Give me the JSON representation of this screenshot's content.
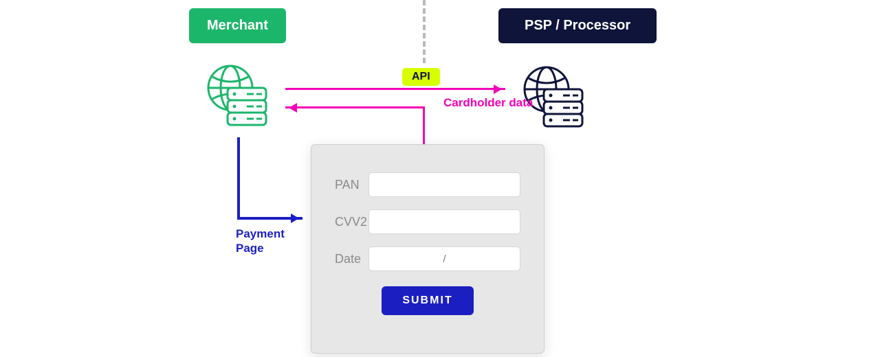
{
  "nodes": {
    "merchant": "Merchant",
    "psp": "PSP / Processor"
  },
  "connectors": {
    "api": "API",
    "cardholder": "Cardholder data",
    "payment_page": "Payment\nPage"
  },
  "form": {
    "fields": {
      "pan": {
        "label": "PAN",
        "value": ""
      },
      "cvv2": {
        "label": "CVV2",
        "value": ""
      },
      "date": {
        "label": "Date",
        "value": "/"
      }
    },
    "submit_label": "SUBMIT"
  },
  "colors": {
    "merchant_green": "#1cb66b",
    "psp_navy": "#0e143a",
    "flow_magenta": "#f400b8",
    "action_blue": "#1b1fc2",
    "api_chip": "#d7ff00"
  }
}
